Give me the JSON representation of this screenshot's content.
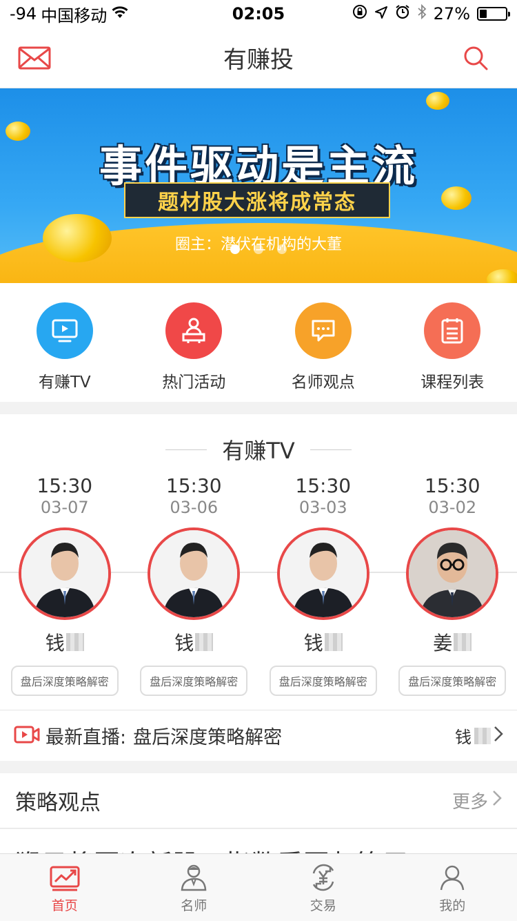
{
  "status_bar": {
    "signal": "-94",
    "carrier": "中国移动",
    "time": "02:05",
    "battery_percent": "27%",
    "battery_level": 0.27
  },
  "nav": {
    "title": "有赚投",
    "left_icon": "mail-icon",
    "right_icon": "search-icon"
  },
  "banner": {
    "headline": "事件驱动是主流",
    "subheadline": "题材股大涨将成常态",
    "caption": "圈主：潜伏在机构的大董",
    "slide_count": 3,
    "active_slide": 0
  },
  "quick_menu": [
    {
      "label": "有赚TV",
      "icon": "tv-icon",
      "color": "#27a7f1"
    },
    {
      "label": "热门活动",
      "icon": "event-icon",
      "color": "#f04848"
    },
    {
      "label": "名师观点",
      "icon": "chat-icon",
      "color": "#f7a229"
    },
    {
      "label": "课程列表",
      "icon": "list-icon",
      "color": "#f56e55"
    }
  ],
  "tv": {
    "section_title": "有赚TV",
    "items": [
      {
        "time": "15:30",
        "date": "03-07",
        "name": "钱",
        "tag": "盘后深度策略解密"
      },
      {
        "time": "15:30",
        "date": "03-06",
        "name": "钱",
        "tag": "盘后深度策略解密"
      },
      {
        "time": "15:30",
        "date": "03-03",
        "name": "钱",
        "tag": "盘后深度策略解密"
      },
      {
        "time": "15:30",
        "date": "03-02",
        "name": "姜",
        "tag": "盘后深度策略解密"
      }
    ]
  },
  "live": {
    "label": "最新直播:",
    "title": "盘后深度策略解密",
    "host": "钱"
  },
  "strategy": {
    "title": "策略观点",
    "more": "更多",
    "first_article": "猴子将回次新股，指数看回归策用"
  },
  "tab_bar": [
    {
      "label": "首页",
      "icon": "home-chart-icon",
      "active": true
    },
    {
      "label": "名师",
      "icon": "teacher-icon",
      "active": false
    },
    {
      "label": "交易",
      "icon": "trade-yen-icon",
      "active": false
    },
    {
      "label": "我的",
      "icon": "profile-icon",
      "active": false
    }
  ],
  "colors": {
    "accent": "#e84848",
    "banner_blue": "#1d8fe8",
    "banner_gold": "#ffc52a"
  }
}
